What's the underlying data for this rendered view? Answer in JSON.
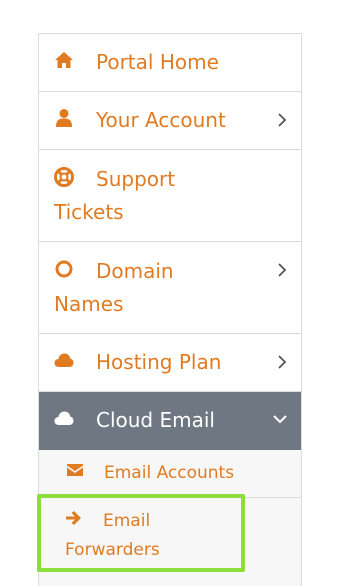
{
  "colors": {
    "accent": "#e07b22",
    "active_bg": "#6e7782",
    "highlight": "#8bde3c"
  },
  "menu": {
    "items": [
      {
        "label": "Portal Home",
        "icon": "home-icon",
        "has_chevron": false
      },
      {
        "label": "Your Account",
        "icon": "user-icon",
        "has_chevron": true
      },
      {
        "label_line1": "Support",
        "label_line2": "Tickets",
        "icon": "lifebuoy-icon",
        "has_chevron": false
      },
      {
        "label_line1": "Domain",
        "label_line2": "Names",
        "icon": "circle-icon",
        "has_chevron": true
      },
      {
        "label": "Hosting Plan",
        "icon": "cloud-icon",
        "has_chevron": true
      },
      {
        "label": "Cloud Email",
        "icon": "cloud-icon",
        "has_chevron": true,
        "expanded": true,
        "active": true
      }
    ],
    "submenu": [
      {
        "label": "Email Accounts",
        "icon": "envelope-icon"
      },
      {
        "label_line1": "Email",
        "label_line2": "Forwarders",
        "icon": "arrow-right-icon",
        "highlighted": true
      }
    ]
  }
}
